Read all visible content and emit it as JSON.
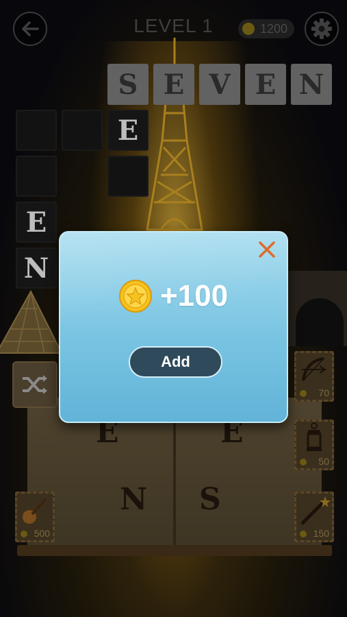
{
  "header": {
    "title": "LEVEL 1",
    "coins": "1200",
    "back_icon": "arrow-left-icon",
    "settings_icon": "gear-icon"
  },
  "answer_word": [
    "S",
    "E",
    "V",
    "E",
    "N"
  ],
  "crossword": {
    "letters": [
      "E",
      "E",
      "N"
    ]
  },
  "letter_wheel": [
    "E",
    "E",
    "N",
    "S"
  ],
  "powerups": [
    {
      "name": "bow-hint",
      "icon": "bow-arrow-icon",
      "price": "70"
    },
    {
      "name": "lantern-hint",
      "icon": "lantern-icon",
      "price": "50"
    },
    {
      "name": "guitar-hint",
      "icon": "guitar-icon",
      "price": "500"
    },
    {
      "name": "wand-hint",
      "icon": "magic-wand-icon",
      "price": "150"
    }
  ],
  "shuffle_icon": "shuffle-icon",
  "reward_dialog": {
    "amount": "+100",
    "button_label": "Add",
    "coin_icon": "coin-star-icon",
    "close_icon": "close-icon"
  },
  "colors": {
    "modal_top": "#a7dcef",
    "modal_bottom": "#62b3d8",
    "close_x": "#e06a2a",
    "add_button": "#2f4a5a",
    "coin_gold": "#f6c21f"
  }
}
